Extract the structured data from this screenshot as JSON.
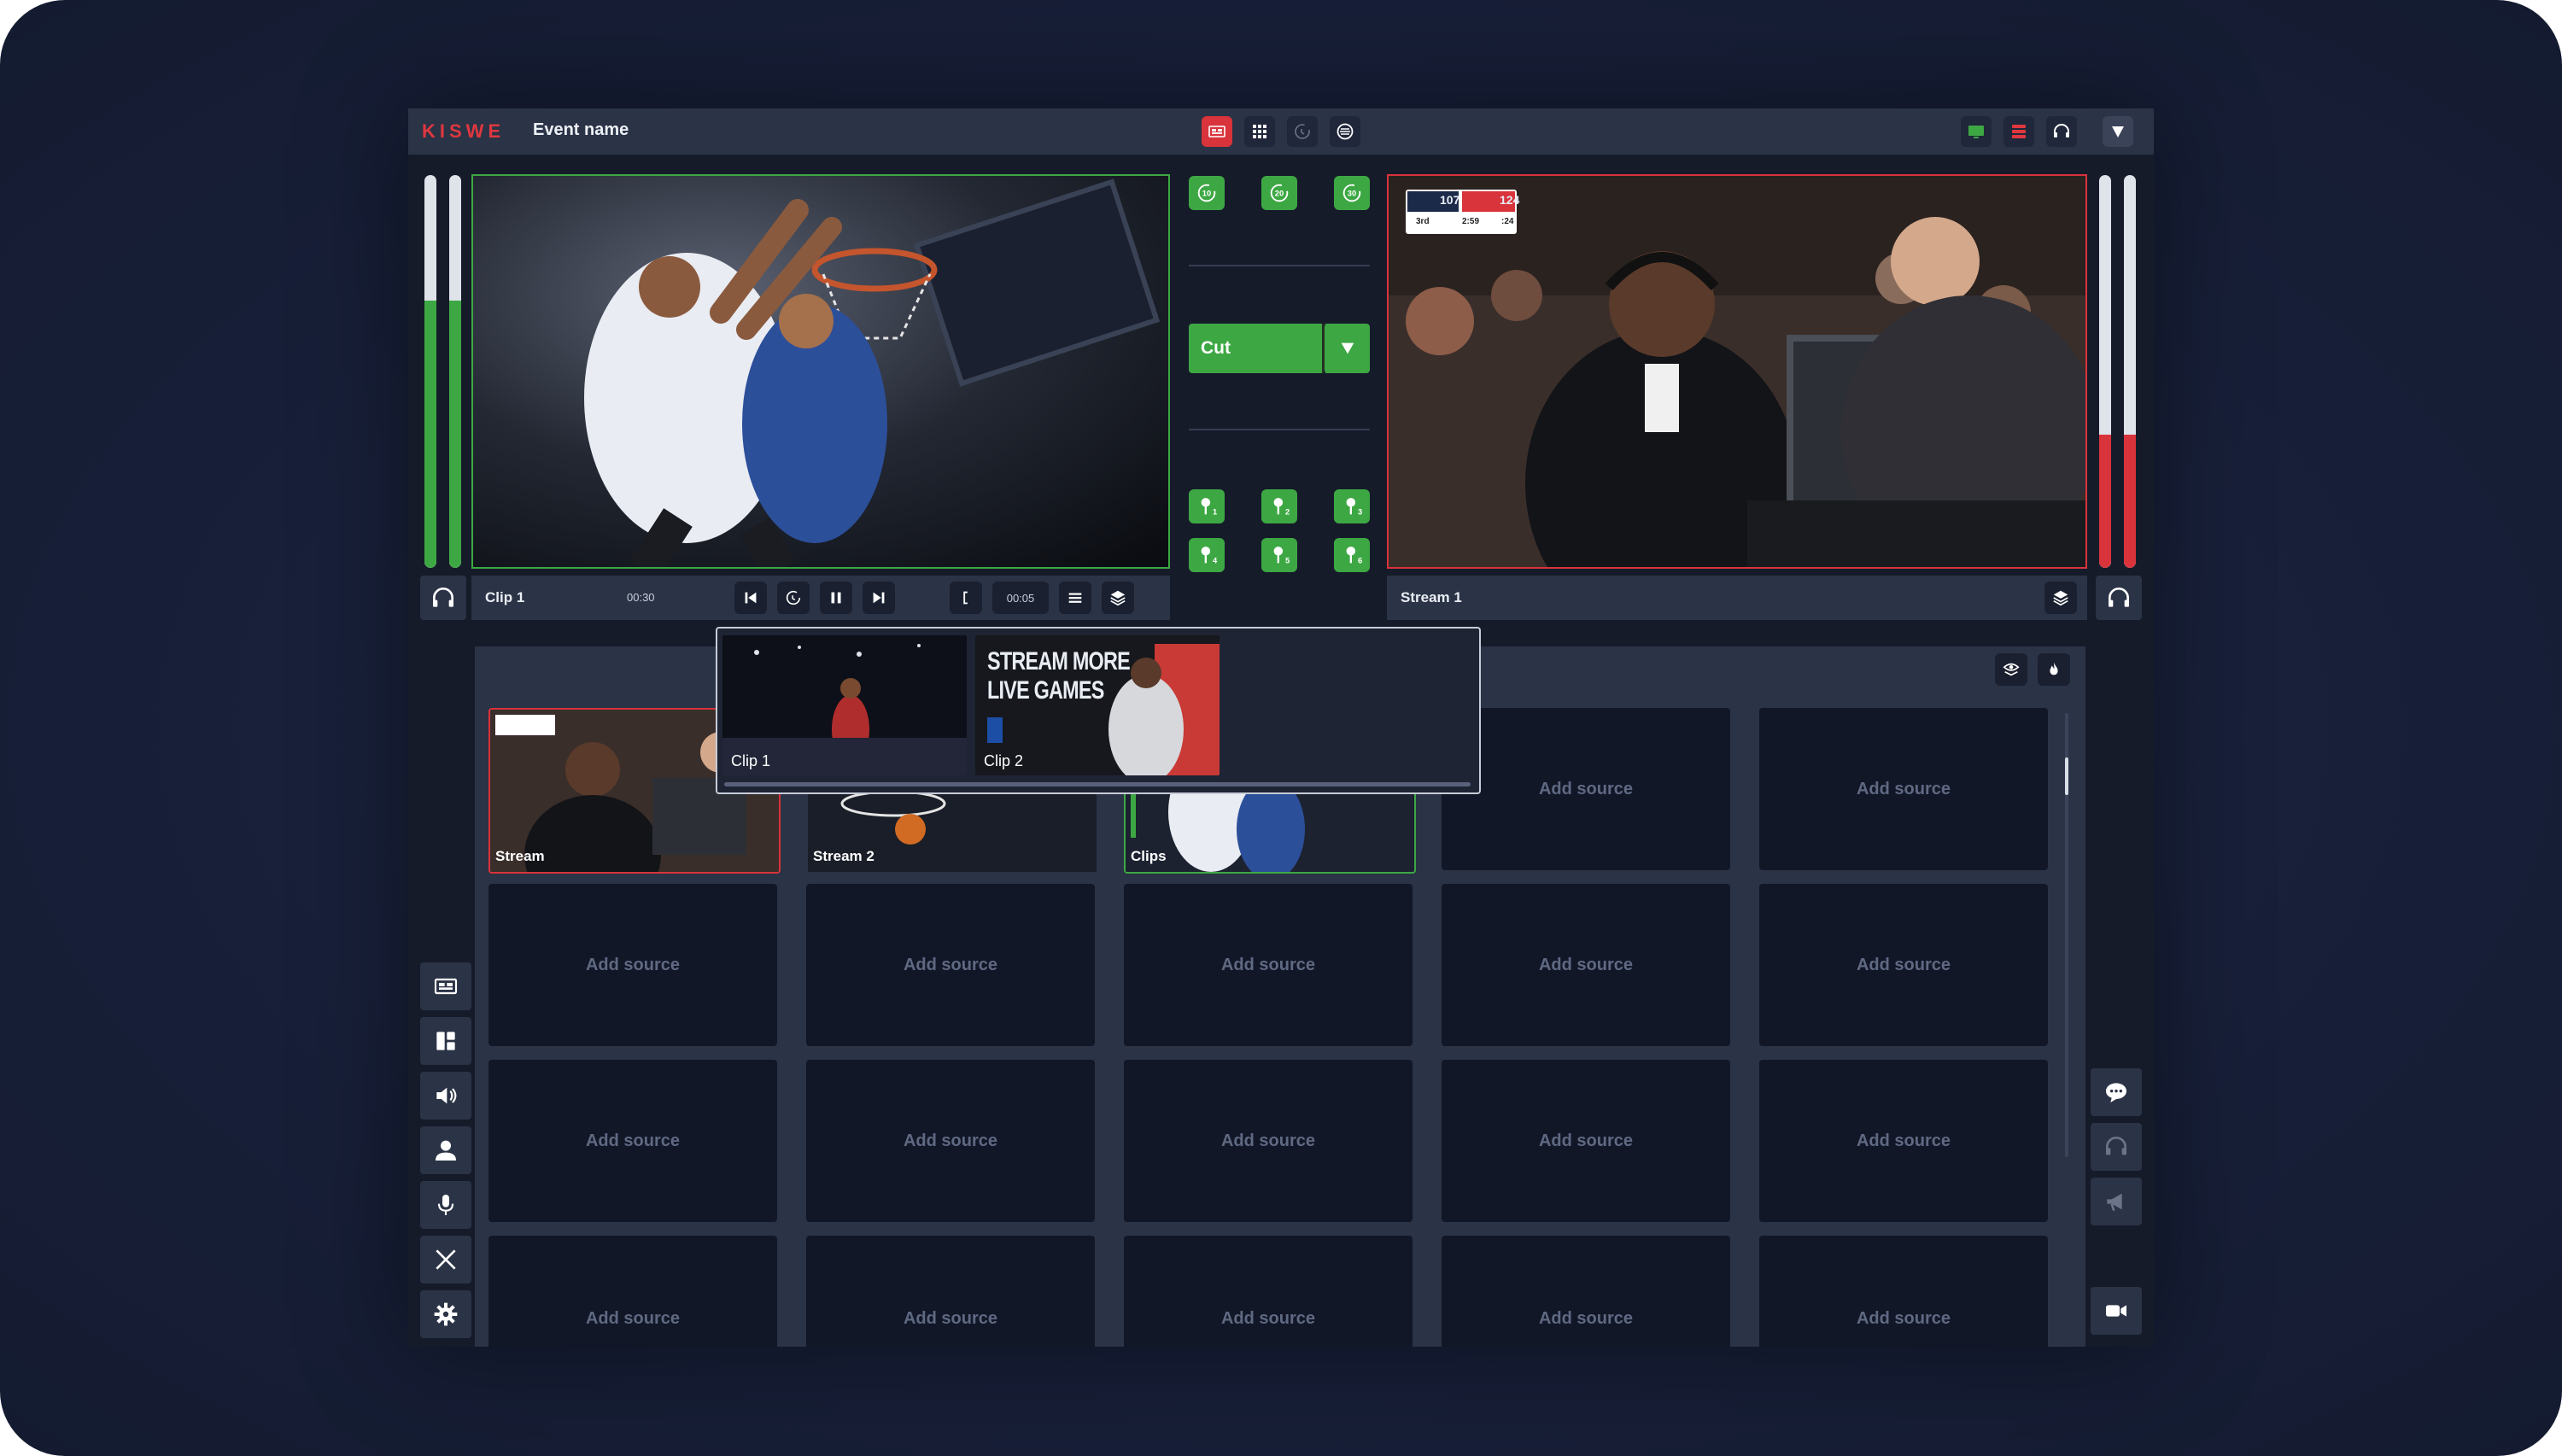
{
  "app": {
    "brand": "KISWE",
    "event_name": "Event name"
  },
  "topbar_left_icons": [
    "multiview-icon",
    "grid-icon",
    "replay-icon",
    "globe-icon"
  ],
  "topbar_right_icons": [
    "monitor-icon",
    "server-icon",
    "headset-icon",
    "dropdown-icon"
  ],
  "colors": {
    "accent_red": "#e0373f",
    "accent_green": "#3da843",
    "panel": "#2b3346",
    "tile": "#121728"
  },
  "preview": {
    "clip_label": "Clip 1",
    "duration": "00:30",
    "loop_time": "00:05",
    "audio_level": 0.68
  },
  "program": {
    "stream_label": "Stream 1",
    "audio_level": 0.34,
    "scorebug": {
      "away_score": "107",
      "home_score": "124",
      "period": "3rd",
      "clock": "2:59",
      "shot_clock": ":24"
    }
  },
  "transition": {
    "label": "Cut",
    "skip_buttons": [
      "10",
      "20",
      "30"
    ],
    "marker_buttons": [
      "1",
      "2",
      "3",
      "4",
      "5",
      "6"
    ]
  },
  "clip_popup": {
    "clips": [
      {
        "name": "Clip 1"
      },
      {
        "name": "Clip 2",
        "promo_line1": "STREAM MORE",
        "promo_line2": "LIVE GAMES"
      }
    ]
  },
  "sources": {
    "stream": "Stream",
    "stream2": "Stream 2",
    "clips": "Clips",
    "placeholder": "Add source"
  },
  "left_sidebar_icons": [
    "multiview-icon",
    "layout-icon",
    "speaker-icon",
    "user-icon",
    "microphone-icon",
    "x-logo-icon",
    "settings-icon"
  ],
  "right_sidebar_icons": [
    "chat-icon",
    "headset-icon",
    "megaphone-icon",
    "camera-icon"
  ]
}
